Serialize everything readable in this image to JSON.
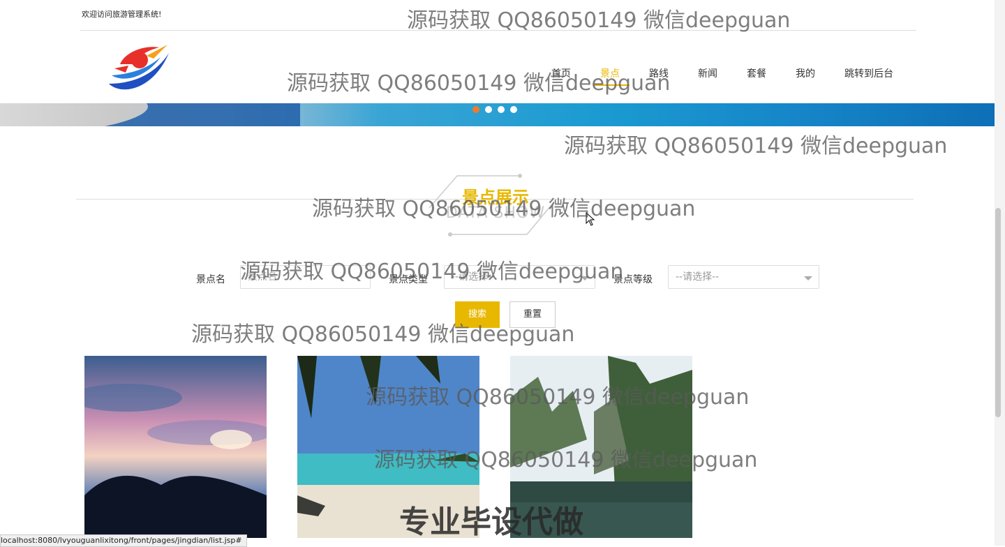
{
  "header": {
    "welcome": "欢迎访问旅游管理系统!",
    "logo_icon": "logo-icon"
  },
  "nav": {
    "items": [
      {
        "label": "首页",
        "active": false
      },
      {
        "label": "景点",
        "active": true
      },
      {
        "label": "路线",
        "active": false
      },
      {
        "label": "新闻",
        "active": false
      },
      {
        "label": "套餐",
        "active": false
      },
      {
        "label": "我的",
        "active": false
      },
      {
        "label": "跳转到后台",
        "active": false
      }
    ],
    "active_color": "#e8b800"
  },
  "carousel": {
    "dots": 4,
    "active_index": 0,
    "active_dot_color": "#f07a2a"
  },
  "section": {
    "title": "景点展示",
    "subtitle": "DATA SHOW"
  },
  "search": {
    "name_label": "景点名",
    "name_placeholder": "景点名",
    "type_label": "景点类型",
    "type_value": "--请选择--",
    "level_label": "景点等级",
    "level_value": "--请选择--",
    "search_button": "搜索",
    "reset_button": "重置"
  },
  "cards": [
    {
      "scene": "sunset-mountains"
    },
    {
      "scene": "tropical-beach"
    },
    {
      "scene": "karst-lake"
    }
  ],
  "status_bar": {
    "url": "localhost:8080/lvyouguanlixitong/front/pages/jingdian/list.jsp#"
  },
  "watermarks": {
    "text": "源码获取 QQ86050149 微信deepguan",
    "big_text": "专业毕设代做"
  }
}
